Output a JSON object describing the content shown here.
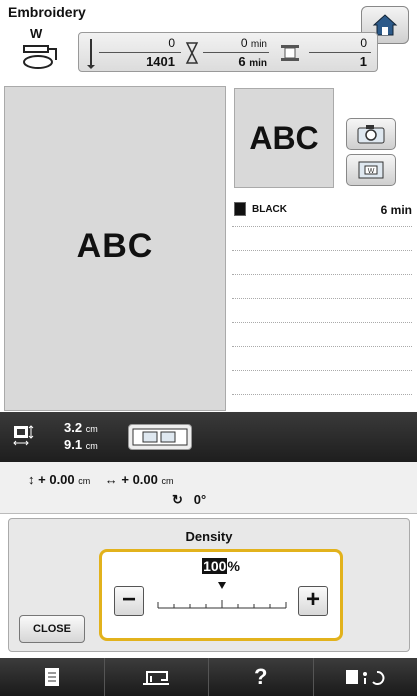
{
  "header": {
    "title": "Embroidery",
    "presser_foot_letter": "W"
  },
  "counter": {
    "stitch_current": "0",
    "stitch_total": "1401",
    "time_current": "0",
    "time_total": "6",
    "time_unit": "min",
    "color_current": "0",
    "color_total": "1"
  },
  "preview": {
    "pattern_text": "ABC"
  },
  "thumbnail": {
    "pattern_text": "ABC"
  },
  "color_list": [
    {
      "name": "BLACK",
      "time": "6 min",
      "color": "#111111"
    }
  ],
  "size": {
    "height": "3.2",
    "width": "9.1",
    "unit": "cm"
  },
  "offset": {
    "vertical_sign": "+",
    "vertical": "0.00",
    "horizontal_sign": "+",
    "horizontal": "0.00",
    "unit": "cm",
    "rotation": "0°"
  },
  "density": {
    "label": "Density",
    "value": "100",
    "unit": "%",
    "minus_label": "−",
    "plus_label": "+"
  },
  "buttons": {
    "close_label": "CLOSE",
    "help_label": "?"
  },
  "colors": {
    "accent": "#e2b21c",
    "dark_bar": "#2a2a2a"
  }
}
